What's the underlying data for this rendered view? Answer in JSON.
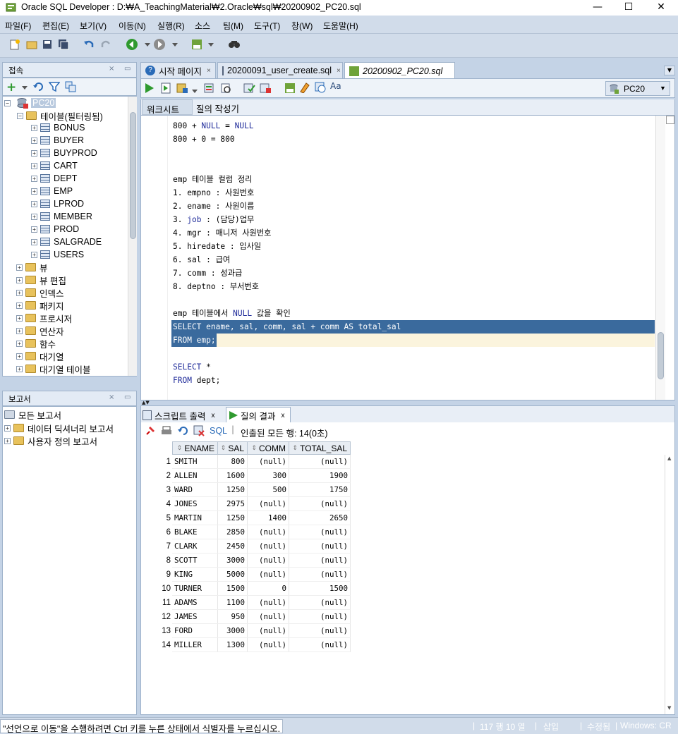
{
  "window": {
    "title": "Oracle SQL Developer : D:₩A_TeachingMaterial₩2.Oracle₩sql₩20200902_PC20.sql",
    "minimize": "—",
    "maximize": "☐",
    "close": "✕"
  },
  "menu": [
    "파일(F)",
    "편집(E)",
    "보기(V)",
    "이동(N)",
    "실행(R)",
    "소스",
    "팀(M)",
    "도구(T)",
    "창(W)",
    "도움말(H)"
  ],
  "connections_panel": {
    "title": "접속",
    "root": "PC20",
    "tables_node": "테이블(필터링됨)",
    "tables": [
      "BONUS",
      "BUYER",
      "BUYPROD",
      "CART",
      "DEPT",
      "EMP",
      "LPROD",
      "MEMBER",
      "PROD",
      "SALGRADE",
      "USERS"
    ],
    "folders": [
      "뷰",
      "뷰 편집",
      "인덱스",
      "패키지",
      "프로시저",
      "연산자",
      "함수",
      "대기열",
      "대기열 테이블"
    ]
  },
  "reports_panel": {
    "title": "보고서",
    "items": [
      "모든 보고서",
      "데이터 딕셔너리 보고서",
      "사용자 정의 보고서"
    ]
  },
  "editor_tabs": [
    {
      "label": "시작 페이지"
    },
    {
      "label": "20200091_user_create.sql"
    },
    {
      "label": "20200902_PC20.sql"
    }
  ],
  "connection_selector": "PC20",
  "worksheet_tabs": [
    "워크시트",
    "질의 작성기"
  ],
  "code_lines": [
    {
      "parts": [
        [
          "800 + ",
          ""
        ],
        [
          "NULL",
          "kw"
        ],
        [
          " = ",
          ""
        ],
        [
          "NULL",
          "kw"
        ]
      ]
    },
    {
      "parts": [
        [
          "800 + 0 = 800",
          ""
        ]
      ]
    },
    {
      "parts": [
        [
          "",
          ""
        ]
      ]
    },
    {
      "parts": [
        [
          "",
          ""
        ]
      ]
    },
    {
      "parts": [
        [
          "emp 테이블 컬럼 정리",
          ""
        ]
      ]
    },
    {
      "parts": [
        [
          "1. empno : 사원번호",
          ""
        ]
      ]
    },
    {
      "parts": [
        [
          "2. ename : 사원이름",
          ""
        ]
      ]
    },
    {
      "parts": [
        [
          "3. ",
          ""
        ],
        [
          "job",
          "kw"
        ],
        [
          " : (담당)업무",
          ""
        ]
      ]
    },
    {
      "parts": [
        [
          "4. mgr : 매니저 사원번호",
          ""
        ]
      ]
    },
    {
      "parts": [
        [
          "5. hiredate : 입사일",
          ""
        ]
      ]
    },
    {
      "parts": [
        [
          "6. sal : 급여",
          ""
        ]
      ]
    },
    {
      "parts": [
        [
          "7. comm : 성과급",
          ""
        ]
      ]
    },
    {
      "parts": [
        [
          "8. deptno : 부서번호",
          ""
        ]
      ]
    },
    {
      "parts": [
        [
          "",
          ""
        ]
      ]
    },
    {
      "parts": [
        [
          "emp 테이블에서 ",
          ""
        ],
        [
          "NULL",
          "kw"
        ],
        [
          " 값을 확인",
          ""
        ]
      ]
    },
    {
      "parts": [
        [
          "SELECT ename, sal, comm, sal + comm AS total_sal",
          "sel"
        ]
      ]
    },
    {
      "parts": [
        [
          "FROM emp;",
          "sel"
        ]
      ]
    },
    {
      "parts": [
        [
          "",
          ""
        ]
      ]
    },
    {
      "parts": [
        [
          "SELECT",
          "kw"
        ],
        [
          " *",
          ""
        ]
      ]
    },
    {
      "parts": [
        [
          "FROM",
          "kw"
        ],
        [
          " dept;",
          ""
        ]
      ]
    }
  ],
  "result_tabs": [
    "스크립트 출력",
    "질의 결과"
  ],
  "result_toolbar": {
    "sql_label": "SQL",
    "fetched": "인출된 모든 행: 14(0초)"
  },
  "grid": {
    "columns": [
      "ENAME",
      "SAL",
      "COMM",
      "TOTAL_SAL"
    ],
    "rows": [
      [
        "1",
        "SMITH",
        "800",
        "(null)",
        "(null)"
      ],
      [
        "2",
        "ALLEN",
        "1600",
        "300",
        "1900"
      ],
      [
        "3",
        "WARD",
        "1250",
        "500",
        "1750"
      ],
      [
        "4",
        "JONES",
        "2975",
        "(null)",
        "(null)"
      ],
      [
        "5",
        "MARTIN",
        "1250",
        "1400",
        "2650"
      ],
      [
        "6",
        "BLAKE",
        "2850",
        "(null)",
        "(null)"
      ],
      [
        "7",
        "CLARK",
        "2450",
        "(null)",
        "(null)"
      ],
      [
        "8",
        "SCOTT",
        "3000",
        "(null)",
        "(null)"
      ],
      [
        "9",
        "KING",
        "5000",
        "(null)",
        "(null)"
      ],
      [
        "10",
        "TURNER",
        "1500",
        "0",
        "1500"
      ],
      [
        "11",
        "ADAMS",
        "1100",
        "(null)",
        "(null)"
      ],
      [
        "12",
        "JAMES",
        "950",
        "(null)",
        "(null)"
      ],
      [
        "13",
        "FORD",
        "3000",
        "(null)",
        "(null)"
      ],
      [
        "14",
        "MILLER",
        "1300",
        "(null)",
        "(null)"
      ]
    ]
  },
  "status": {
    "message": "\"선언으로 이동\"을 수행하려면 Ctrl 키를 누른 상태에서 식별자를 누르십시오.",
    "position": "117 행 10 열",
    "mode": "삽입",
    "modified": "수정됨",
    "line_ending": "Windows: CR"
  }
}
